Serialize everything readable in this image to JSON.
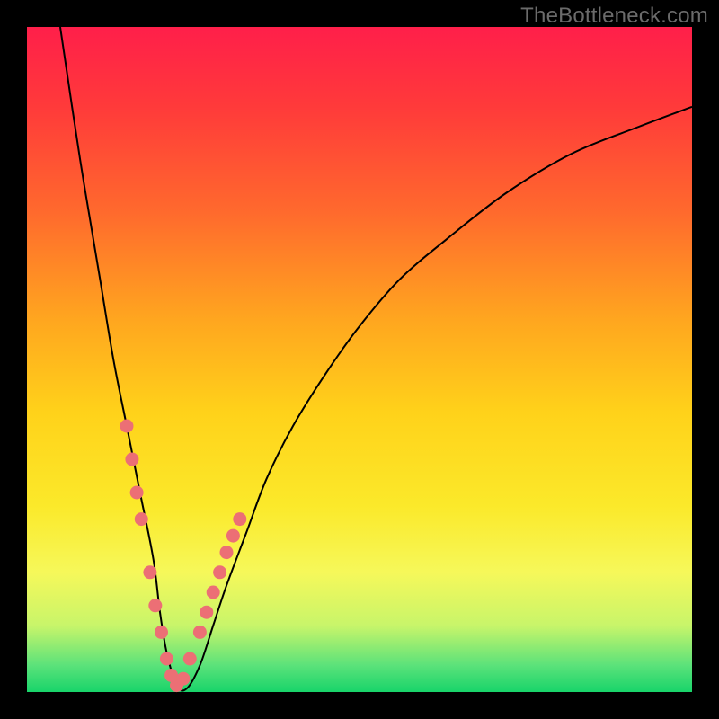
{
  "watermark": "TheBottleneck.com",
  "colors": {
    "frame": "#000000",
    "dot": "#ec6f75",
    "curve": "#000000",
    "gradient_stops": [
      "#ff1f4a",
      "#ff3a3a",
      "#ff6a2d",
      "#ffa61f",
      "#ffd21a",
      "#fbe92a",
      "#f6f85a",
      "#c8f56a",
      "#5be27a",
      "#18d46a"
    ]
  },
  "chart_data": {
    "type": "line",
    "title": "",
    "xlabel": "",
    "ylabel": "",
    "xlim": [
      0,
      100
    ],
    "ylim": [
      0,
      100
    ],
    "grid": false,
    "series": [
      {
        "name": "bottleneck-curve",
        "x": [
          5,
          8,
          11,
          13,
          15,
          17,
          19,
          20,
          21,
          22.5,
          24,
          26,
          28,
          30,
          33,
          36,
          40,
          45,
          50,
          56,
          63,
          72,
          82,
          92,
          100
        ],
        "y": [
          100,
          80,
          62,
          50,
          40,
          30,
          20,
          12,
          6,
          1,
          0.5,
          4,
          10,
          16,
          24,
          32,
          40,
          48,
          55,
          62,
          68,
          75,
          81,
          85,
          88
        ]
      }
    ],
    "highlight_points": {
      "name": "sample-dots",
      "x": [
        15.0,
        15.8,
        16.5,
        17.2,
        18.5,
        19.3,
        20.2,
        21.0,
        21.7,
        22.5,
        23.5,
        24.5,
        26.0,
        27.0,
        28.0,
        29.0,
        30.0,
        31.0,
        32.0
      ],
      "y": [
        40,
        35,
        30,
        26,
        18,
        13,
        9,
        5,
        2.5,
        1,
        2,
        5,
        9,
        12,
        15,
        18,
        21,
        23.5,
        26
      ]
    }
  }
}
